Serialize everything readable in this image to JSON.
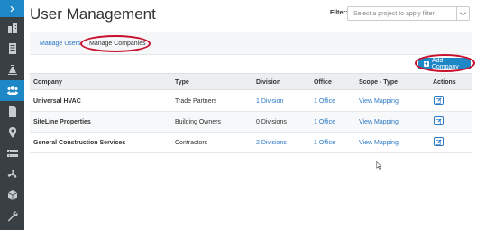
{
  "page": {
    "title": "User Management"
  },
  "filter": {
    "label": "Filter:",
    "placeholder": "Select a project to apply filter"
  },
  "tabs": [
    {
      "label": "Manage Users"
    },
    {
      "label": "Manage Companies"
    }
  ],
  "add_button": {
    "label": "Add Company"
  },
  "sidebar": {
    "items": [
      {
        "icon": "chevron-right-icon"
      },
      {
        "icon": "buildings-icon"
      },
      {
        "icon": "document-list-icon"
      },
      {
        "icon": "construction-icon"
      },
      {
        "icon": "users-icon",
        "active": true
      },
      {
        "icon": "file-icon"
      },
      {
        "icon": "map-pin-icon"
      },
      {
        "icon": "equipment-icon"
      },
      {
        "icon": "fan-icon"
      },
      {
        "icon": "box-icon"
      },
      {
        "icon": "wrench-icon"
      }
    ]
  },
  "table": {
    "headers": [
      "Company",
      "Type",
      "Division",
      "Office",
      "Scope - Type",
      "Actions"
    ],
    "rows": [
      {
        "company": "Universal HVAC",
        "type": "Trade Partners",
        "division": "1 Division",
        "office": "1 Office",
        "scope": "View Mapping"
      },
      {
        "company": "SiteLine Properties",
        "type": "Building Owners",
        "division": "0 Divisions",
        "office": "1 Office",
        "scope": "View Mapping"
      },
      {
        "company": "General Construction Services",
        "type": "Contractors",
        "division": "2 Divisions",
        "office": "1 Office",
        "scope": "View Mapping"
      }
    ]
  },
  "colors": {
    "accent": "#1e88c7",
    "sidebar": "#3a3f44",
    "link": "#2b78c5",
    "annotation": "#c8102e"
  }
}
